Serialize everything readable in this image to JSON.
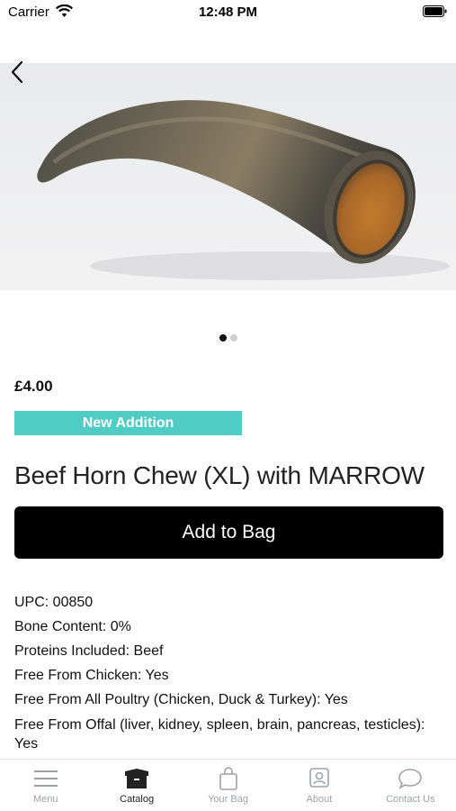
{
  "status_bar": {
    "carrier": "Carrier",
    "time": "12:48 PM"
  },
  "product": {
    "image_alt": "Beef horn chew",
    "carousel": {
      "count": 2,
      "active": 0
    },
    "price": "£4.00",
    "badge": "New Addition",
    "title": "Beef Horn Chew (XL) with MARROW",
    "add_button_label": "Add to Bag",
    "specs": [
      "UPC: 00850",
      "Bone Content: 0%",
      "Proteins Included: Beef",
      "Free From Chicken: Yes",
      "Free From All Poultry (Chicken, Duck & Turkey): Yes",
      "Free From Offal (liver, kidney, spleen, brain, pancreas, testicles): Yes"
    ]
  },
  "tab_bar": {
    "items": [
      {
        "label": "Menu",
        "icon": "menu-icon",
        "active": false
      },
      {
        "label": "Catalog",
        "icon": "catalog-icon",
        "active": true
      },
      {
        "label": "Your Bag",
        "icon": "bag-icon",
        "active": false
      },
      {
        "label": "About",
        "icon": "about-icon",
        "active": false
      },
      {
        "label": "Contact Us",
        "icon": "chat-icon",
        "active": false
      }
    ]
  },
  "colors": {
    "badge": "#4fcdc4",
    "button": "#000000",
    "tab_inactive": "#9aa3ab"
  }
}
